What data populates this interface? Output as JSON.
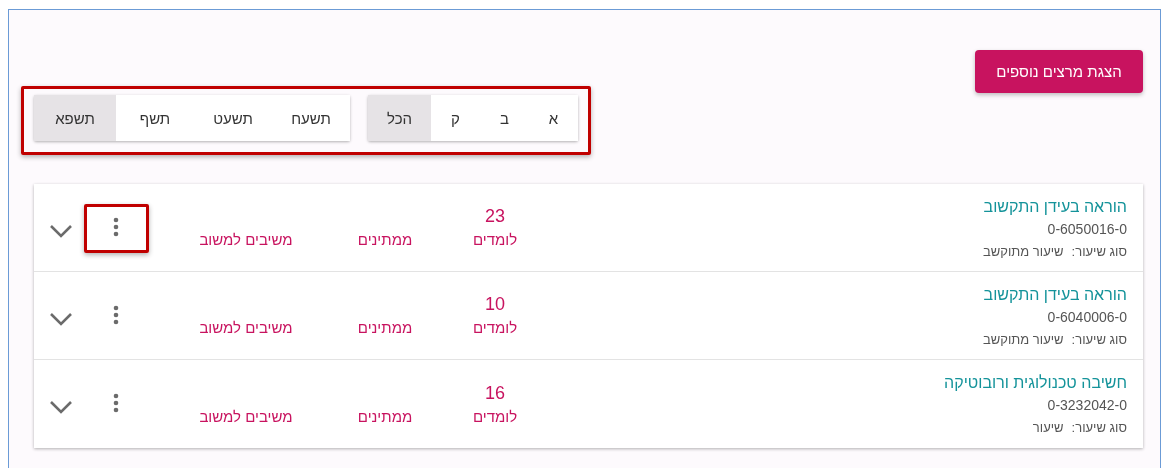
{
  "more_button": "הצגת מרצים נוספים",
  "filters": {
    "highlighted": true,
    "letter_tabs": [
      {
        "label": "א",
        "selected": false
      },
      {
        "label": "ב",
        "selected": false
      },
      {
        "label": "ק",
        "selected": false
      },
      {
        "label": "הכל",
        "selected": true
      }
    ],
    "year_tabs": [
      {
        "label": "תשעח",
        "selected": false
      },
      {
        "label": "תשעט",
        "selected": false
      },
      {
        "label": "תשף",
        "selected": false
      },
      {
        "label": "תשפא",
        "selected": true
      }
    ]
  },
  "courses": [
    {
      "title": "הוראה בעידן התקשוב",
      "code": "0-6050016-0",
      "type_label": "סוג שיעור:",
      "type_value": "שיעור מתוקשב",
      "count": "23",
      "count_label": "לומדים",
      "waiting_label": "ממתינים",
      "feedback_label": "משיבים למשוב",
      "menu_highlighted": true
    },
    {
      "title": "הוראה בעידן התקשוב",
      "code": "0-6040006-0",
      "type_label": "סוג שיעור:",
      "type_value": "שיעור מתוקשב",
      "count": "10",
      "count_label": "לומדים",
      "waiting_label": "ממתינים",
      "feedback_label": "משיבים למשוב",
      "menu_highlighted": false
    },
    {
      "title": "חשיבה טכנולוגית ורובוטיקה",
      "code": "0-3232042-0",
      "type_label": "סוג שיעור:",
      "type_value": "שיעור",
      "count": "16",
      "count_label": "לומדים",
      "waiting_label": "ממתינים",
      "feedback_label": "משיבים למשוב",
      "menu_highlighted": false
    }
  ]
}
